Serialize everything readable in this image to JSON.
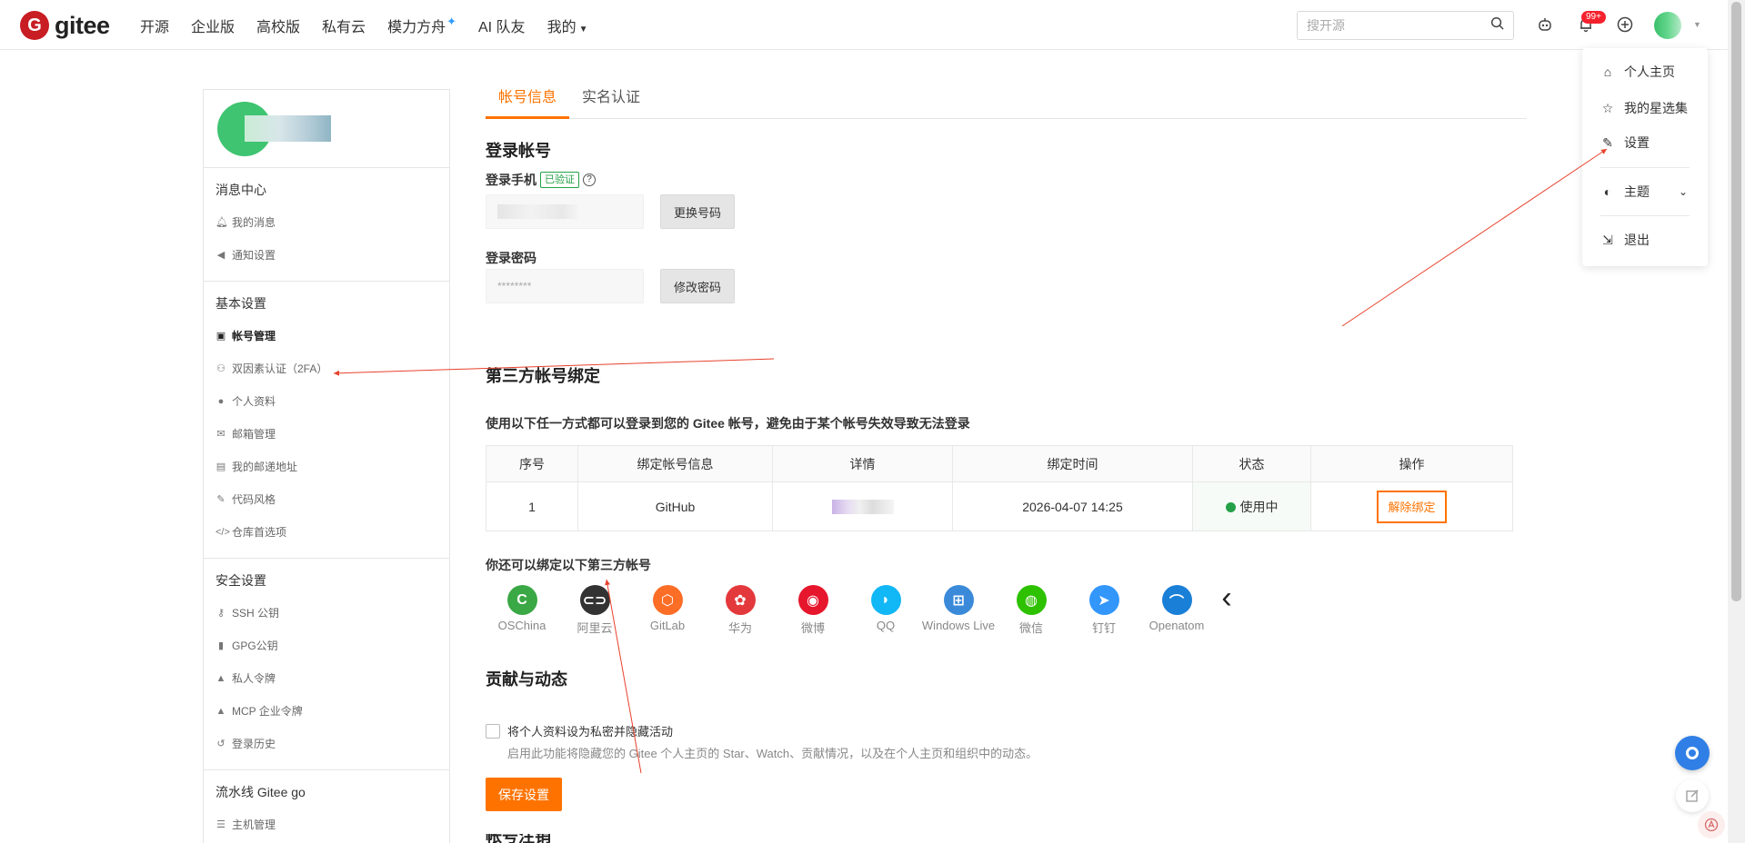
{
  "header": {
    "logo_letter": "G",
    "logo_text": "gitee",
    "nav": [
      "开源",
      "企业版",
      "高校版",
      "私有云",
      "模力方舟",
      "AI 队友",
      "我的"
    ],
    "nav_spark": "✦",
    "search_placeholder": "搜开源",
    "notification_badge": "99+"
  },
  "dropdown": {
    "items": [
      "个人主页",
      "我的星选集",
      "设置",
      "主题",
      "退出"
    ]
  },
  "sidebar": {
    "groups": [
      {
        "title": "消息中心",
        "items": [
          "我的消息",
          "通知设置"
        ]
      },
      {
        "title": "基本设置",
        "items": [
          "帐号管理",
          "双因素认证（2FA）",
          "个人资料",
          "邮箱管理",
          "我的邮递地址",
          "代码风格",
          "仓库首选项"
        ]
      },
      {
        "title": "安全设置",
        "items": [
          "SSH 公钥",
          "GPG公钥",
          "私人令牌",
          "MCP 企业令牌",
          "登录历史"
        ]
      },
      {
        "title": "流水线 Gitee go",
        "items": [
          "主机管理"
        ]
      }
    ]
  },
  "tabs": [
    "帐号信息",
    "实名认证"
  ],
  "login": {
    "title": "登录帐号",
    "phone_label": "登录手机",
    "verified_badge": "已验证",
    "help_mark": "?",
    "change_phone_button": "更换号码",
    "password_label": "登录密码",
    "password_mask": "********",
    "change_password_button": "修改密码"
  },
  "third_party": {
    "title": "第三方帐号绑定",
    "description": "使用以下任一方式都可以登录到您的 Gitee 帐号，避免由于某个帐号失效导致无法登录",
    "table_headers": [
      "序号",
      "绑定帐号信息",
      "详情",
      "绑定时间",
      "状态",
      "操作"
    ],
    "rows": [
      {
        "index": "1",
        "account": "GitHub",
        "bound_time": "2026-04-07 14:25",
        "status": "使用中",
        "action": "解除绑定"
      }
    ],
    "more_title": "你还可以绑定以下第三方帐号",
    "providers": [
      {
        "name": "OSChina",
        "glyph": "C",
        "color": "#3aa845"
      },
      {
        "name": "阿里云",
        "glyph": "⊂⊃",
        "color": "#333333"
      },
      {
        "name": "GitLab",
        "glyph": "⬡",
        "color": "#fc6d26"
      },
      {
        "name": "华为",
        "glyph": "✿",
        "color": "#e4393c"
      },
      {
        "name": "微博",
        "glyph": "◉",
        "color": "#e6162d"
      },
      {
        "name": "QQ",
        "glyph": "◗",
        "color": "#12b7f5"
      },
      {
        "name": "Windows Live",
        "glyph": "⊞",
        "color": "#3b8ad9"
      },
      {
        "name": "微信",
        "glyph": "◍",
        "color": "#2dc100"
      },
      {
        "name": "钉钉",
        "glyph": "➤",
        "color": "#3296fa"
      },
      {
        "name": "Openatom",
        "glyph": "⌒",
        "color": "#1a7fd6"
      }
    ],
    "prev_glyph": "‹"
  },
  "contribution": {
    "title": "贡献与动态",
    "checkbox_label": "将个人资料设为私密并隐藏活动",
    "checkbox_hint": "启用此功能将隐藏您的 Gitee 个人主页的 Star、Watch、贡献情况，以及在个人主页和组织中的动态。",
    "save_button": "保存设置",
    "next_section_partial": "帐号注销"
  },
  "colors": {
    "brand_orange": "#fe7300",
    "gitee_red": "#c71d23",
    "status_green": "#24a148",
    "annotation_arrow": "#e8412c"
  }
}
